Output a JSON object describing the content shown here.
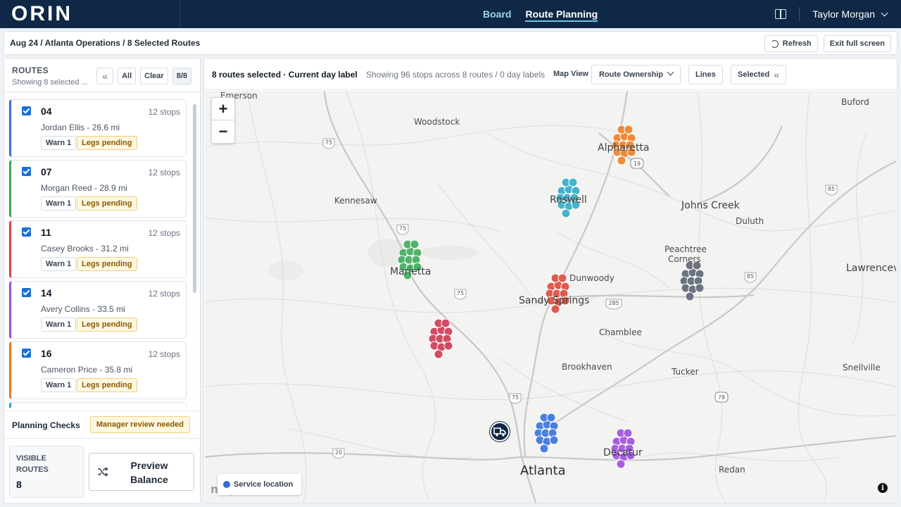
{
  "app": {
    "logo": "ORIN"
  },
  "nav": {
    "links": [
      {
        "label": "Board"
      },
      {
        "label": "Route Planning"
      }
    ],
    "user": "Taylor Morgan"
  },
  "breadcrumb": {
    "text": "Aug 24 / Atlanta Operations / 8 Selected Routes",
    "refresh": "Refresh",
    "exit": "Exit full screen"
  },
  "sidebar": {
    "title": "ROUTES",
    "subtitle": "Showing 8 selected ...",
    "all": "All",
    "clear": "Clear",
    "count": "8/8",
    "routes": [
      {
        "num": "04",
        "stops": "12 stops",
        "driver": "Jordan Ellis - 26.6 mi",
        "warn": "Warn 1",
        "legs": "Legs pending",
        "color": "#3b6fd4"
      },
      {
        "num": "07",
        "stops": "12 stops",
        "driver": "Morgan Reed - 28.9 mi",
        "warn": "Warn 1",
        "legs": "Legs pending",
        "color": "#3aa55a"
      },
      {
        "num": "11",
        "stops": "12 stops",
        "driver": "Casey Brooks - 31.2 mi",
        "warn": "Warn 1",
        "legs": "Legs pending",
        "color": "#d24545"
      },
      {
        "num": "14",
        "stops": "12 stops",
        "driver": "Avery Collins - 33.5 mi",
        "warn": "Warn 1",
        "legs": "Legs pending",
        "color": "#9a4fd0"
      },
      {
        "num": "16",
        "stops": "12 stops",
        "driver": "Cameron Price - 35.8 mi",
        "warn": "Warn 1",
        "legs": "Legs pending",
        "color": "#e07a2e"
      }
    ],
    "checks_label": "Planning Checks",
    "manager_badge": "Manager review needed",
    "visible_label": "VISIBLE ROUTES",
    "visible_value": "8",
    "preview": "Preview Balance"
  },
  "map_panel": {
    "title": "8 routes selected · Current day label",
    "info": "Showing 96 stops across 8 routes / 0 day labels",
    "map_view_label": "Map View",
    "select_value": "Route Ownership",
    "lines": "Lines",
    "selected": "Selected",
    "legend": "Service location",
    "attribution": "mapbox",
    "zoom_in": "+",
    "zoom_out": "−",
    "info_icon": "i",
    "places": [
      {
        "name": "Emerson",
        "size": "small"
      },
      {
        "name": "Woodstock",
        "size": "small"
      },
      {
        "name": "Buford",
        "size": "small"
      },
      {
        "name": "Alpharetta",
        "size": "mid"
      },
      {
        "name": "Roswell",
        "size": "mid"
      },
      {
        "name": "Kennesaw",
        "size": "small"
      },
      {
        "name": "Johns Creek",
        "size": "mid"
      },
      {
        "name": "Duluth",
        "size": "small"
      },
      {
        "name": "Marietta",
        "size": "mid"
      },
      {
        "name": "Peachtree",
        "size": "small"
      },
      {
        "name": "Corners",
        "size": "small"
      },
      {
        "name": "Lawrenceville",
        "size": "mid"
      },
      {
        "name": "Dunwoody",
        "size": "small"
      },
      {
        "name": "Sandy Springs",
        "size": "mid"
      },
      {
        "name": "Chamblee",
        "size": "small"
      },
      {
        "name": "Brookhaven",
        "size": "small"
      },
      {
        "name": "Tucker",
        "size": "small"
      },
      {
        "name": "Snellville",
        "size": "small"
      },
      {
        "name": "Atlanta",
        "size": "big"
      },
      {
        "name": "Decatur",
        "size": "mid"
      },
      {
        "name": "Redan",
        "size": "small"
      }
    ],
    "highway_shields": [
      "75",
      "75",
      "75",
      "75",
      "285",
      "85",
      "85",
      "19",
      "20",
      "78"
    ],
    "clusters": [
      {
        "route": "16",
        "color": "#ef8a3a"
      },
      {
        "route": "roswell",
        "color": "#45b3cc"
      },
      {
        "route": "07",
        "color": "#4fb36a"
      },
      {
        "route": "11",
        "color": "#e05a4d"
      },
      {
        "route": "gray",
        "color": "#6b7280"
      },
      {
        "route": "red2",
        "color": "#d14b63"
      },
      {
        "route": "04",
        "color": "#4a7fe0"
      },
      {
        "route": "14",
        "color": "#a65fde"
      }
    ]
  }
}
